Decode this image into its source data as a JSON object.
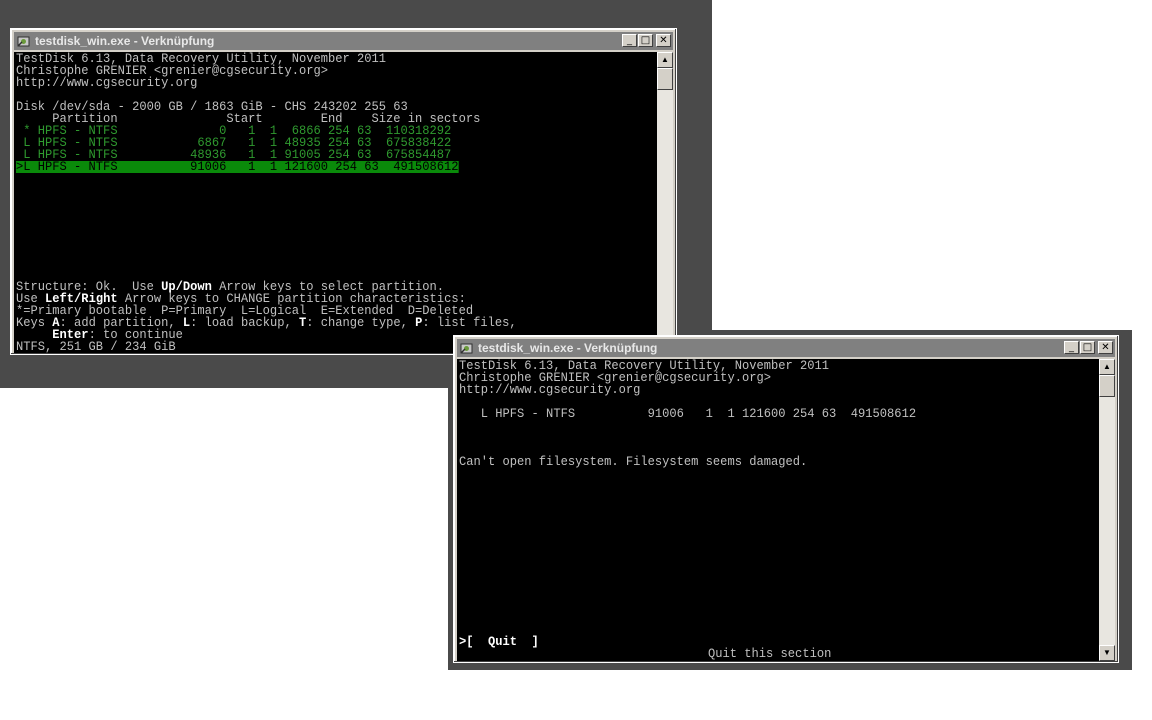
{
  "window1": {
    "title": "testdisk_win.exe - Verknüpfung",
    "buttons": {
      "minimize": "_",
      "maximize": "□",
      "close": "✕"
    },
    "header": [
      "TestDisk 6.13, Data Recovery Utility, November 2011",
      "Christophe GRENIER <grenier@cgsecurity.org>",
      "http://www.cgsecurity.org"
    ],
    "disk_line": "Disk /dev/sda - 2000 GB / 1863 GiB - CHS 243202 255 63",
    "column_header": "     Partition               Start        End    Size in sectors",
    "partitions": [
      " * HPFS - NTFS              0   1  1  6866 254 63  110318292",
      " L HPFS - NTFS           6867   1  1 48935 254 63  675838422",
      " L HPFS - NTFS          48936   1  1 91005 254 63  675854487"
    ],
    "selected_partition": ">L HPFS - NTFS          91006   1  1 121600 254 63  491508612",
    "help_line1": {
      "a": "Structure: Ok.  Use ",
      "b": "Up/Down",
      "c": " Arrow keys to select partition."
    },
    "help_line2": {
      "a": "Use ",
      "b": "Left/Right",
      "c": " Arrow keys to CHANGE partition characteristics:"
    },
    "help_line3": "*=Primary bootable  P=Primary  L=Logical  E=Extended  D=Deleted",
    "help_line4": {
      "a": "Keys ",
      "b": "A",
      "c": ": add partition, ",
      "d": "L",
      "e": ": load backup, ",
      "f": "T",
      "g": ": change type, ",
      "h": "P",
      "i": ": list files,"
    },
    "help_line5": {
      "a": "     ",
      "b": "Enter",
      "c": ": to continue"
    },
    "status_line": "NTFS, 251 GB / 234 GiB"
  },
  "window2": {
    "title": "testdisk_win.exe - Verknüpfung",
    "buttons": {
      "minimize": "_",
      "maximize": "□",
      "close": "✕"
    },
    "header": [
      "TestDisk 6.13, Data Recovery Utility, November 2011",
      "Christophe GRENIER <grenier@cgsecurity.org>",
      "http://www.cgsecurity.org"
    ],
    "partition_line": "   L HPFS - NTFS          91006   1  1 121600 254 63  491508612",
    "error_message": "Can't open filesystem. Filesystem seems damaged.",
    "quit_button": ">[  Quit  ]",
    "quit_hint": "Quit this section"
  },
  "scroll": {
    "up": "▲",
    "down": "▼"
  }
}
